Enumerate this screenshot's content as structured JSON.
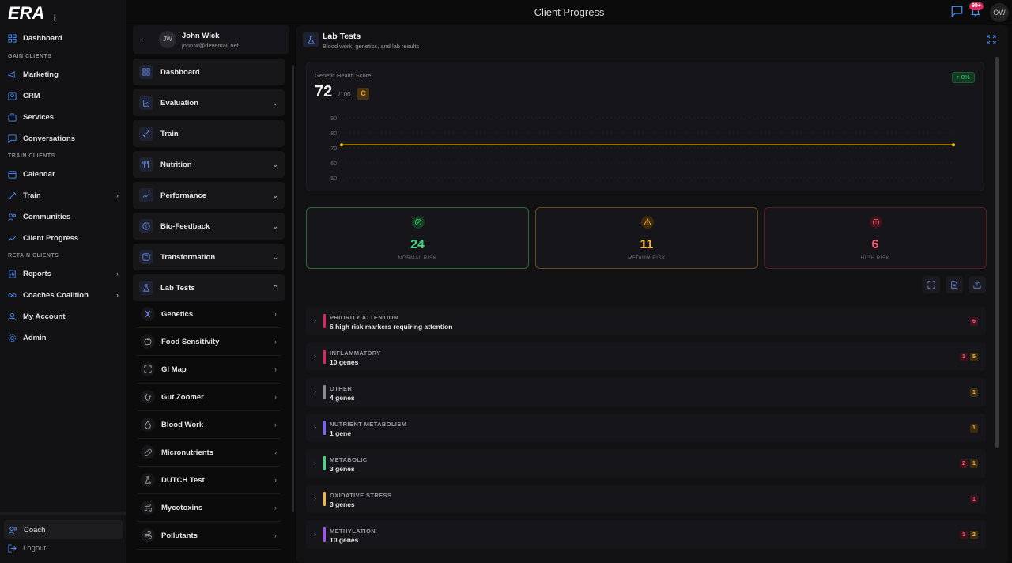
{
  "topbar": {
    "title": "Client Progress",
    "notif_badge": "99+",
    "user_initials": "OW"
  },
  "nav": {
    "sections": [
      "GAIN CLIENTS",
      "TRAIN CLIENTS",
      "RETAIN CLIENTS"
    ],
    "items": [
      "Dashboard",
      "Marketing",
      "CRM",
      "Services",
      "Conversations",
      "Calendar",
      "Train",
      "Communities",
      "Client Progress",
      "Reports",
      "Coaches Coalition",
      "My Account",
      "Admin"
    ],
    "coach": "Coach",
    "logout": "Logout"
  },
  "client": {
    "initials": "JW",
    "name": "John Wick",
    "email": "john.w@devemail.net"
  },
  "menu": [
    "Dashboard",
    "Evaluation",
    "Train",
    "Nutrition",
    "Performance",
    "Bio-Feedback",
    "Transformation",
    "Lab Tests"
  ],
  "submenu": [
    "Genetics",
    "Food Sensitivity",
    "GI Map",
    "Gut Zoomer",
    "Blood Work",
    "Micronutrients",
    "DUTCH Test",
    "Mycotoxins",
    "Pollutants"
  ],
  "main": {
    "title": "Lab Tests",
    "subtitle": "Blood work, genetics, and lab results",
    "score_label": "Genetic Health Score",
    "score": "72",
    "score_of": "/100",
    "grade": "C",
    "change": "0%"
  },
  "chart_data": {
    "type": "line",
    "title": "",
    "yticks": [
      "90",
      "80",
      "70",
      "60",
      "50"
    ],
    "ylim": [
      50,
      90
    ],
    "series": [
      {
        "values": [
          72,
          72
        ]
      }
    ]
  },
  "risk": [
    {
      "value": "24",
      "label": "NORMAL RISK",
      "color": "#3ddc84"
    },
    {
      "value": "11",
      "label": "MEDIUM RISK",
      "color": "#f5b642"
    },
    {
      "value": "6",
      "label": "HIGH RISK",
      "color": "#ff5c7a"
    }
  ],
  "categories": [
    {
      "name": "PRIORITY ATTENTION",
      "count": "6 high risk markers requiring attention",
      "color": "#e0245e",
      "red": "6",
      "amber": ""
    },
    {
      "name": "INFLAMMATORY",
      "count": "10 genes",
      "color": "#e0245e",
      "red": "1",
      "amber": "5"
    },
    {
      "name": "OTHER",
      "count": "4 genes",
      "color": "#8a8a8e",
      "red": "",
      "amber": "1"
    },
    {
      "name": "NUTRIENT METABOLISM",
      "count": "1 gene",
      "color": "#7b61ff",
      "red": "",
      "amber": "1"
    },
    {
      "name": "METABOLIC",
      "count": "3 genes",
      "color": "#3ddc84",
      "red": "2",
      "amber": "1"
    },
    {
      "name": "OXIDATIVE STRESS",
      "count": "3 genes",
      "color": "#f5b642",
      "red": "1",
      "amber": ""
    },
    {
      "name": "METHYLATION",
      "count": "10 genes",
      "color": "#a64dff",
      "red": "1",
      "amber": "2"
    }
  ]
}
